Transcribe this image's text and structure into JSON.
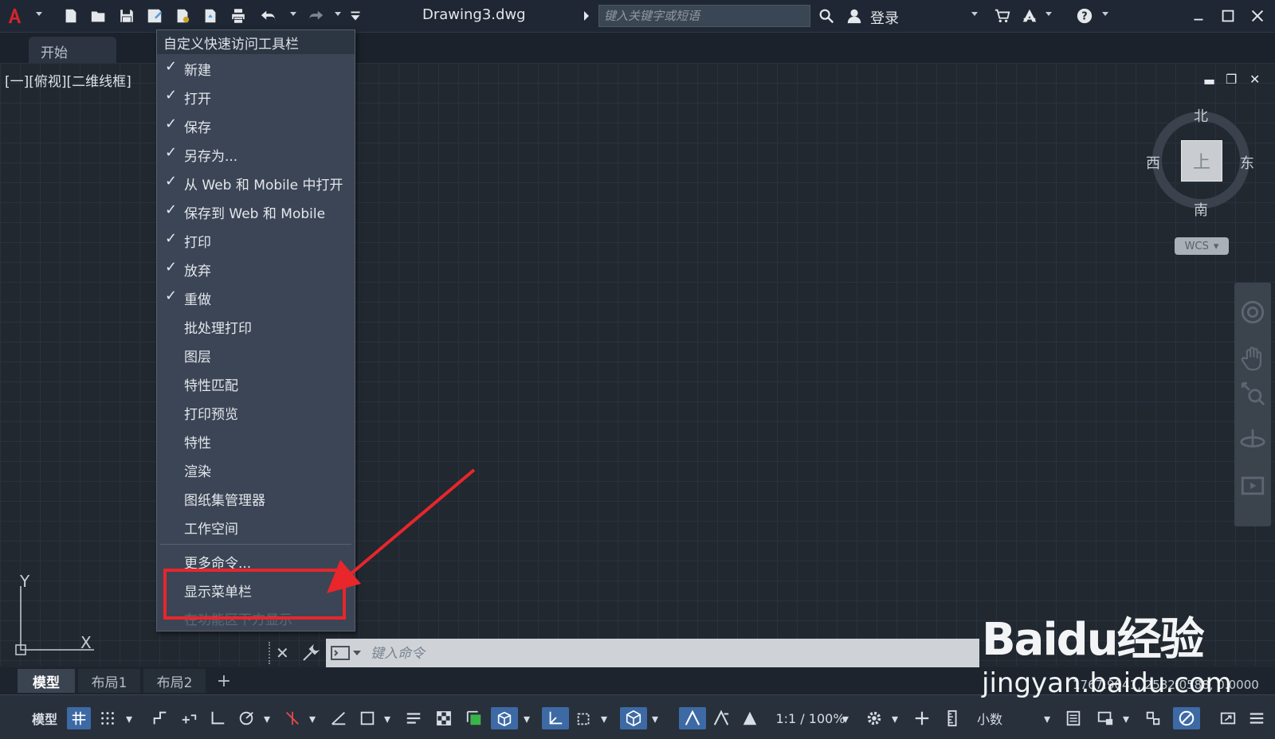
{
  "titlebar": {
    "title": "Drawing3.dwg",
    "search_placeholder": "键入关键字或短语",
    "login_label": "登录"
  },
  "tabs": {
    "start_tab": "开始"
  },
  "viewport": {
    "label": "[一][俯视][二维线框]",
    "viewcube": {
      "top_face": "上",
      "north": "北",
      "south": "南",
      "east": "东",
      "west": "西",
      "wcs_label": "WCS"
    },
    "ucs": {
      "y_label": "Y",
      "x_label": "X"
    }
  },
  "menu": {
    "header": "自定义快速访问工具栏",
    "items": [
      {
        "label": "新建",
        "checked": "✓"
      },
      {
        "label": "打开",
        "checked": "✓"
      },
      {
        "label": "保存",
        "checked": "✓"
      },
      {
        "label": "另存为...",
        "checked": "✓"
      },
      {
        "label": "从 Web 和 Mobile 中打开",
        "checked": "✓"
      },
      {
        "label": "保存到 Web 和 Mobile",
        "checked": "✓"
      },
      {
        "label": "打印",
        "checked": "✓"
      },
      {
        "label": "放弃",
        "checked": "✓"
      },
      {
        "label": "重做",
        "checked": "✓"
      },
      {
        "label": "批处理打印",
        "checked": ""
      },
      {
        "label": "图层",
        "checked": ""
      },
      {
        "label": "特性匹配",
        "checked": ""
      },
      {
        "label": "打印预览",
        "checked": ""
      },
      {
        "label": "特性",
        "checked": ""
      },
      {
        "label": "渲染",
        "checked": ""
      },
      {
        "label": "图纸集管理器",
        "checked": ""
      },
      {
        "label": "工作空间",
        "checked": ""
      }
    ],
    "more_commands": "更多命令...",
    "show_menubar": "显示菜单栏",
    "show_below_ribbon": "在功能区下方显示"
  },
  "commandline": {
    "placeholder": "键入命令"
  },
  "layout_tabs": {
    "model": "模型",
    "layout1": "布局1",
    "layout2": "布局2",
    "add": "+"
  },
  "statusbar": {
    "model_label": "模型",
    "scale": "1:1 / 100%",
    "units": "小数",
    "coords": "1767.9041, 2582.0588, 0.0000"
  },
  "watermark": {
    "brand": "Baidu经验",
    "url": "jingyan.baidu.com"
  },
  "colors": {
    "accent_red": "#e8262b",
    "active_blue": "#3d6aa5",
    "app_logo_red": "#d0262c"
  }
}
